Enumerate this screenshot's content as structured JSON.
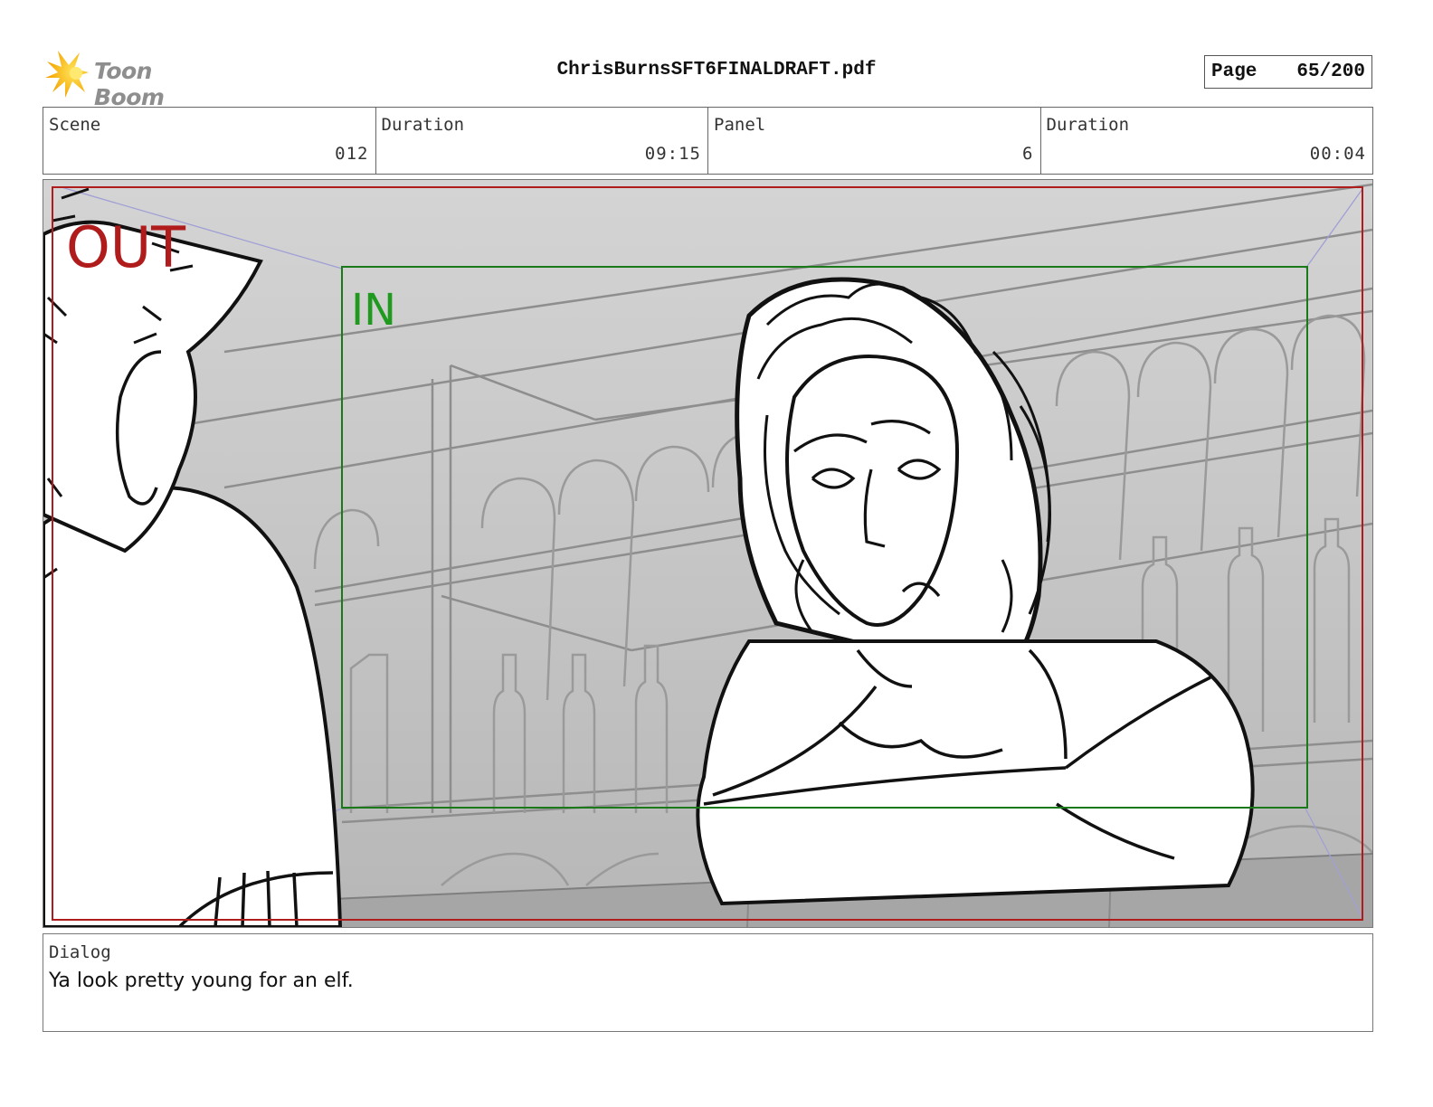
{
  "header": {
    "logo_text": "Toon Boom",
    "document_title": "ChrisBurnsSFT6FINALDRAFT.pdf",
    "page_label": "Page",
    "page_value": "65/200"
  },
  "info": {
    "scene_label": "Scene",
    "scene_value": "012",
    "duration_label": "Duration",
    "duration_value": "09:15",
    "panel_label": "Panel",
    "panel_value": "6",
    "panel_duration_label": "Duration",
    "panel_duration_value": "00:04"
  },
  "panel": {
    "out_label": "OUT",
    "in_label": "IN",
    "colors": {
      "out_frame": "#b01c1c",
      "in_frame": "#1a7a1a",
      "in_text": "#1f9a1f"
    }
  },
  "dialog": {
    "label": "Dialog",
    "text": "Ya look pretty young for an elf."
  }
}
